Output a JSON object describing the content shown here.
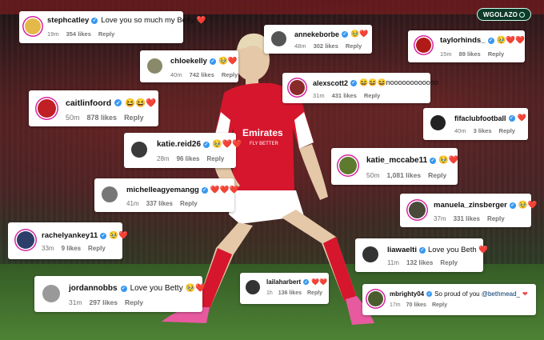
{
  "watermark": {
    "label": "WGOLAZO"
  },
  "comments": [
    {
      "id": "stephcatley",
      "username": "stephcatley",
      "text": "Love you so much my Beffy ❤️",
      "time": "19m",
      "likes": "354 likes",
      "reply": "Reply",
      "avatar_color": "#e4b94a"
    },
    {
      "id": "annekeborbe",
      "username": "annekeborbe",
      "text": "🥹❤️",
      "time": "48m",
      "likes": "302 likes",
      "reply": "Reply",
      "avatar_color": "#555"
    },
    {
      "id": "taylorhinds",
      "username": "taylorhinds_",
      "text": "🥹❤️❤️",
      "time": "15m",
      "likes": "89 likes",
      "reply": "Reply",
      "avatar_color": "#b21a1a"
    },
    {
      "id": "chloekelly",
      "username": "chloekelly",
      "text": "🥹❤️",
      "time": "40m",
      "likes": "742 likes",
      "reply": "Reply",
      "avatar_color": "#8a8a6a"
    },
    {
      "id": "alexscott2",
      "username": "alexscott2",
      "text": "😆😆😆noooooooooooo",
      "time": "31m",
      "likes": "431 likes",
      "reply": "Reply",
      "avatar_color": "#8a2b2b"
    },
    {
      "id": "caitlinfoord",
      "username": "caitlinfoord",
      "text": "😆😆❤️",
      "time": "50m",
      "likes": "878 likes",
      "reply": "Reply",
      "avatar_color": "#c01f25"
    },
    {
      "id": "fifaclubfootball",
      "username": "fifaclubfootball",
      "text": "❤️",
      "time": "40m",
      "likes": "3 likes",
      "reply": "Reply",
      "avatar_color": "#222"
    },
    {
      "id": "katiereid26",
      "username": "katie.reid26",
      "text": "🥹❤️❤️",
      "time": "28m",
      "likes": "96 likes",
      "reply": "Reply",
      "avatar_color": "#3a3a3a"
    },
    {
      "id": "katiemccabe11",
      "username": "katie_mccabe11",
      "text": "🥹❤️",
      "time": "50m",
      "likes": "1,081 likes",
      "reply": "Reply",
      "avatar_color": "#5e7a2e"
    },
    {
      "id": "michelleagyemangg",
      "username": "michelleagyemangg",
      "text": "❤️❤️❤️",
      "time": "41m",
      "likes": "337 likes",
      "reply": "Reply",
      "avatar_color": "#777"
    },
    {
      "id": "manuelazinsberger",
      "username": "manuela_zinsberger",
      "text": "🥹❤️",
      "time": "37m",
      "likes": "331 likes",
      "reply": "Reply",
      "avatar_color": "#4a4a3a"
    },
    {
      "id": "rachelyankey11",
      "username": "rachelyankey11",
      "text": "🥹❤️",
      "time": "33m",
      "likes": "9 likes",
      "reply": "Reply",
      "avatar_color": "#2d3e6b"
    },
    {
      "id": "liawaelti",
      "username": "liawaelti",
      "text": "Love you Beth ❤️",
      "time": "11m",
      "likes": "132 likes",
      "reply": "Reply",
      "avatar_color": "#333"
    },
    {
      "id": "jordannobbs",
      "username": "jordannobbs",
      "text": "Love you Betty 🥹❤️",
      "time": "31m",
      "likes": "297 likes",
      "reply": "Reply",
      "avatar_color": "#999"
    },
    {
      "id": "lailaharbert",
      "username": "lailaharbert",
      "text": "❤️❤️",
      "time": "1h",
      "likes": "136 likes",
      "reply": "Reply",
      "avatar_color": "#333"
    },
    {
      "id": "mbrighty04",
      "username": "mbrighty04",
      "text": "So proud of you ",
      "mention": "@bethmead_",
      "time": "17m",
      "likes": "70 likes",
      "reply": "Reply",
      "avatar_color": "#4b5c2e"
    }
  ]
}
